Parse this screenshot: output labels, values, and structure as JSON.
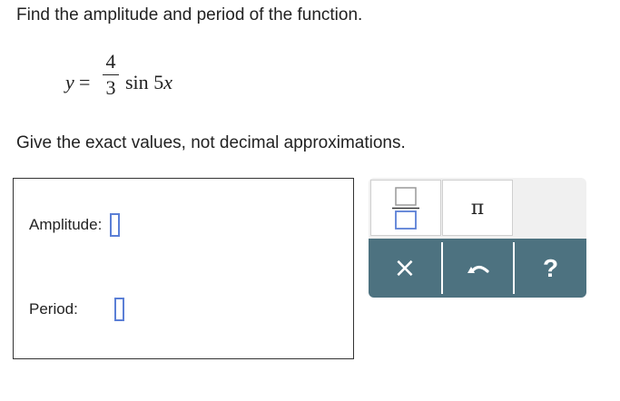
{
  "question": {
    "prompt": "Find the amplitude and period of the function.",
    "equation": {
      "lhs": "y",
      "equals": "=",
      "numerator": "4",
      "denominator": "3",
      "function": "sin",
      "coefficient": "5",
      "variable": "x"
    },
    "instruction": "Give the exact values, not decimal approximations."
  },
  "answer_form": {
    "amplitude_label": "Amplitude:",
    "period_label": "Period:"
  },
  "math_toolbar": {
    "pi_symbol": "π",
    "clear_symbol": "×",
    "help_symbol": "?",
    "tool_icons": [
      "fraction-icon",
      "pi-symbol",
      "clear-icon",
      "undo-icon",
      "help-icon"
    ]
  },
  "colors": {
    "slot_border": "#5b7fd6",
    "toolbar_action_bg": "#4d7280",
    "toolbar_bg": "#f0f0f0"
  }
}
